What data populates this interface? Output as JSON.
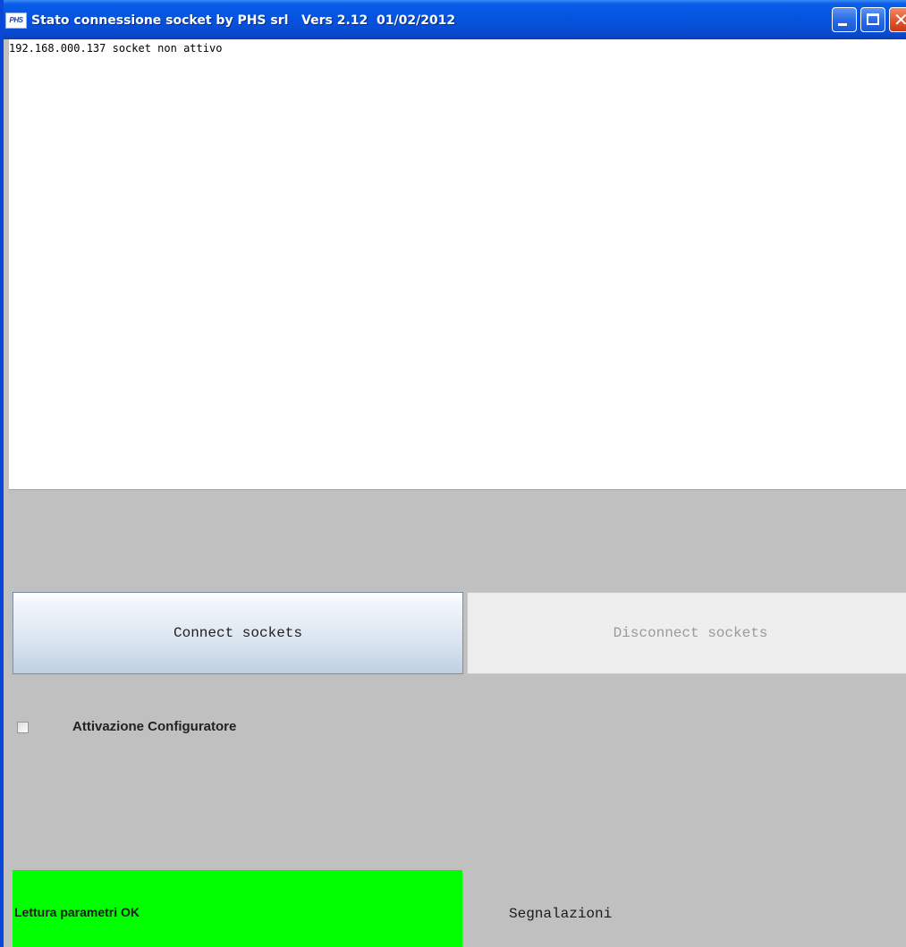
{
  "window": {
    "title": "Stato connessione socket by PHS srl   Vers 2.12  01/02/2012",
    "icon_label": "PHS",
    "icon": "app-icon",
    "controls": {
      "minimize_icon": "minimize-icon",
      "maximize_icon": "maximize-icon",
      "close_icon": "close-icon",
      "close_glyph": "✕"
    }
  },
  "log": {
    "lines": [
      "192.168.000.137 socket non attivo"
    ]
  },
  "buttons": {
    "connect_label": "Connect sockets",
    "disconnect_label": "Disconnect sockets"
  },
  "configurator": {
    "label": "Attivazione Configuratore",
    "checked": false
  },
  "status": {
    "message": "Lettura parametri OK",
    "color": "#00ff00",
    "notifications_label": "Segnalazioni"
  }
}
